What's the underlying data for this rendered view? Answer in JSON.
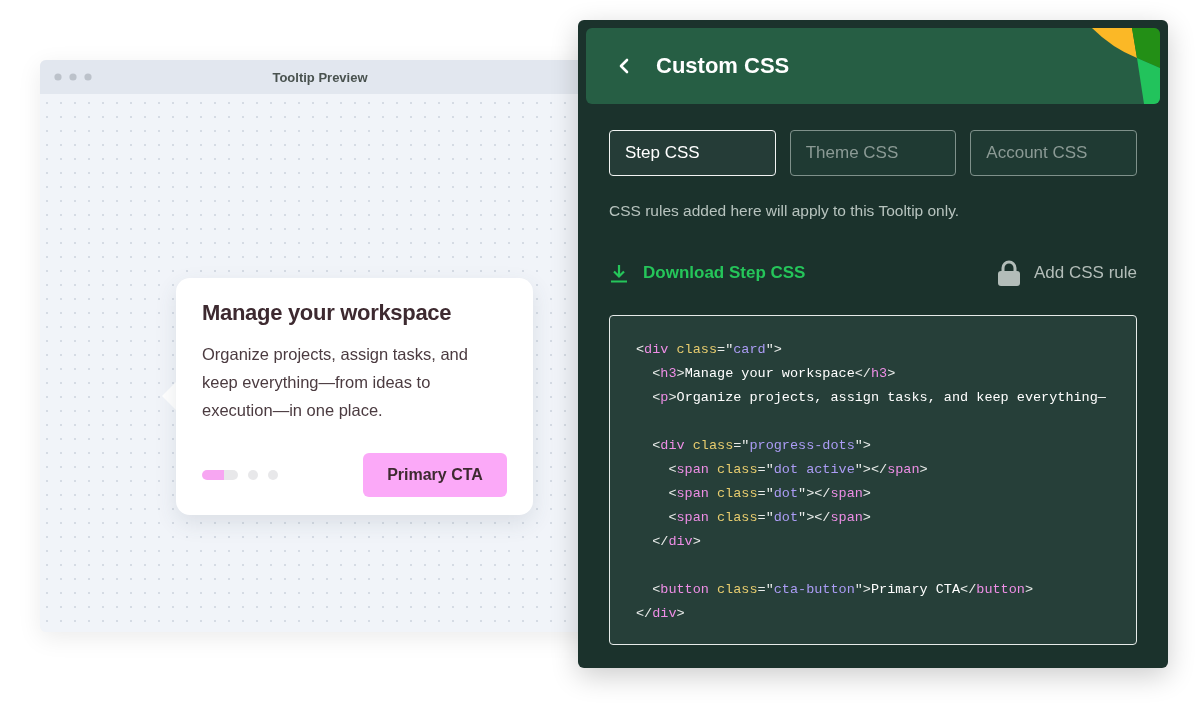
{
  "preview_window": {
    "title": "Tooltip Preview",
    "tooltip": {
      "heading": "Manage your workspace",
      "body": "Organize projects, assign tasks, and keep everything—from ideas to execution—in one place.",
      "progress_dots": [
        {
          "selected": true
        },
        {
          "selected": false
        },
        {
          "selected": false
        }
      ],
      "button": "Primary CTA"
    }
  },
  "panel": {
    "title": "Custom CSS",
    "tabs": [
      {
        "label": "Step CSS",
        "selected": true
      },
      {
        "label": "Theme CSS",
        "selected": false
      },
      {
        "label": "Account CSS",
        "selected": false
      }
    ],
    "hint": "CSS rules added here will apply to this Tooltip only.",
    "download_link": "Download Step CSS",
    "add_rule": {
      "label": "Add CSS rule",
      "disabled": true
    },
    "code_lines": [
      {
        "kind": "code",
        "tokens": [
          {
            "kind": "punct",
            "text": "<"
          },
          {
            "kind": "tag",
            "text": "div"
          },
          {
            "kind": "attr",
            "text": " class"
          },
          {
            "kind": "punct",
            "text": "=\""
          },
          {
            "kind": "value",
            "text": "card"
          },
          {
            "kind": "punct",
            "text": "\">"
          }
        ]
      },
      {
        "kind": "code",
        "tokens": [
          {
            "kind": "punct",
            "text": "  <"
          },
          {
            "kind": "tag",
            "text": "h3"
          },
          {
            "kind": "punct",
            "text": ">"
          },
          {
            "kind": "text",
            "text": "Manage your workspace"
          },
          {
            "kind": "punct",
            "text": "</"
          },
          {
            "kind": "tag",
            "text": "h3"
          },
          {
            "kind": "punct",
            "text": ">"
          }
        ]
      },
      {
        "kind": "code",
        "tokens": [
          {
            "kind": "punct",
            "text": "  <"
          },
          {
            "kind": "tag",
            "text": "p"
          },
          {
            "kind": "punct",
            "text": ">"
          },
          {
            "kind": "text",
            "text": "Organize projects, assign tasks, and keep everything—"
          }
        ]
      },
      {
        "kind": "blank"
      },
      {
        "kind": "code",
        "tokens": [
          {
            "kind": "punct",
            "text": "  <"
          },
          {
            "kind": "tag",
            "text": "div"
          },
          {
            "kind": "attr",
            "text": " class"
          },
          {
            "kind": "punct",
            "text": "=\""
          },
          {
            "kind": "value",
            "text": "progress-dots"
          },
          {
            "kind": "punct",
            "text": "\">"
          }
        ]
      },
      {
        "kind": "code",
        "tokens": [
          {
            "kind": "punct",
            "text": "    <"
          },
          {
            "kind": "tag",
            "text": "span"
          },
          {
            "kind": "attr",
            "text": " class"
          },
          {
            "kind": "punct",
            "text": "=\""
          },
          {
            "kind": "value",
            "text": "dot active"
          },
          {
            "kind": "punct",
            "text": "\"></"
          },
          {
            "kind": "tag",
            "text": "span"
          },
          {
            "kind": "punct",
            "text": ">"
          }
        ]
      },
      {
        "kind": "code",
        "tokens": [
          {
            "kind": "punct",
            "text": "    <"
          },
          {
            "kind": "tag",
            "text": "span"
          },
          {
            "kind": "attr",
            "text": " class"
          },
          {
            "kind": "punct",
            "text": "=\""
          },
          {
            "kind": "value",
            "text": "dot"
          },
          {
            "kind": "punct",
            "text": "\"></"
          },
          {
            "kind": "tag",
            "text": "span"
          },
          {
            "kind": "punct",
            "text": ">"
          }
        ]
      },
      {
        "kind": "code",
        "tokens": [
          {
            "kind": "punct",
            "text": "    <"
          },
          {
            "kind": "tag",
            "text": "span"
          },
          {
            "kind": "attr",
            "text": " class"
          },
          {
            "kind": "punct",
            "text": "=\""
          },
          {
            "kind": "value",
            "text": "dot"
          },
          {
            "kind": "punct",
            "text": "\"></"
          },
          {
            "kind": "tag",
            "text": "span"
          },
          {
            "kind": "punct",
            "text": ">"
          }
        ]
      },
      {
        "kind": "code",
        "tokens": [
          {
            "kind": "punct",
            "text": "  </"
          },
          {
            "kind": "tag",
            "text": "div"
          },
          {
            "kind": "punct",
            "text": ">"
          }
        ]
      },
      {
        "kind": "blank"
      },
      {
        "kind": "code",
        "tokens": [
          {
            "kind": "punct",
            "text": "  <"
          },
          {
            "kind": "tag",
            "text": "button"
          },
          {
            "kind": "attr",
            "text": " class"
          },
          {
            "kind": "punct",
            "text": "=\""
          },
          {
            "kind": "value",
            "text": "cta-button"
          },
          {
            "kind": "punct",
            "text": "\">"
          },
          {
            "kind": "text",
            "text": "Primary CTA"
          },
          {
            "kind": "punct",
            "text": "</"
          },
          {
            "kind": "tag",
            "text": "button"
          },
          {
            "kind": "punct",
            "text": ">"
          }
        ]
      },
      {
        "kind": "code",
        "tokens": [
          {
            "kind": "punct",
            "text": "</"
          },
          {
            "kind": "tag",
            "text": "div"
          },
          {
            "kind": "punct",
            "text": ">"
          }
        ]
      }
    ]
  }
}
